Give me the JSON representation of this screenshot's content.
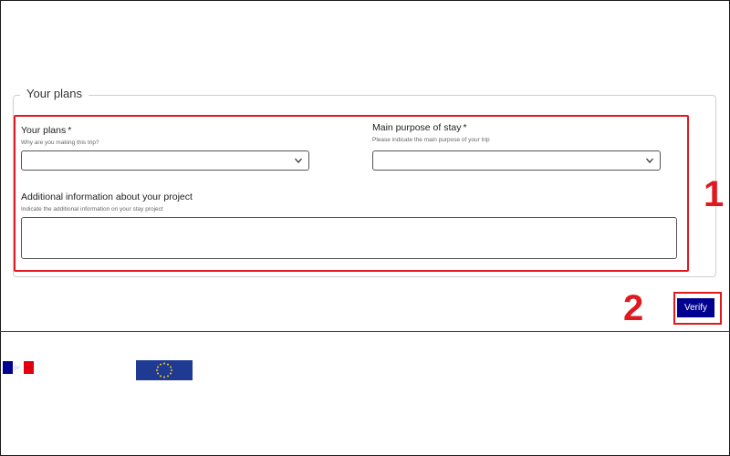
{
  "section": {
    "legend": "Your plans"
  },
  "form": {
    "plans": {
      "label": "Your plans",
      "required_mark": "*",
      "hint": "Why are you making this trip?",
      "value": ""
    },
    "purpose": {
      "label": "Main purpose of stay",
      "required_mark": "*",
      "hint": "Please indicate the main purpose of your trip",
      "value": ""
    },
    "additional": {
      "label": "Additional information about your project",
      "hint": "Indicate the additional information on your stay project",
      "value": ""
    }
  },
  "annotations": {
    "step1": "1",
    "step2": "2"
  },
  "actions": {
    "verify_label": "Verify"
  },
  "colors": {
    "highlight": "#e0191f",
    "primary": "#000091",
    "eu_blue": "#1f3a93",
    "eu_star": "#ffcc00",
    "fr_blue": "#000091",
    "fr_red": "#e1000f"
  },
  "icons": {
    "select_arrow": "chevron-down-icon",
    "logo_left": "french-republic-flag-icon",
    "logo_right": "eu-flag-icon"
  }
}
